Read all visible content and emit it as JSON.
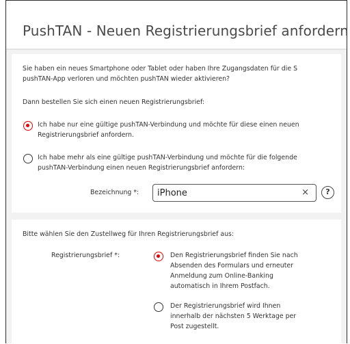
{
  "title": "PushTAN - Neuen Registrierungsbrief anfordern",
  "intro": {
    "line1": "Sie haben ein neues Smartphone oder Tablet oder haben Ihre Zugangsdaten für die S",
    "line2": "pushTAN-App verloren und möchten pushTAN wieder aktivieren?",
    "prompt": "Dann bestellen Sie sich einen neuen Registrierungsbrief:"
  },
  "options": [
    {
      "selected": true,
      "line1": "Ich habe nur eine gültige pushTAN-Verbindung und möchte für diese einen neuen",
      "line2": "Registrierungsbrief anfordern."
    },
    {
      "selected": false,
      "line1": "Ich habe mehr als eine gültige pushTAN-Verbindung und möchte für die folgende",
      "line2": "pushTAN-Verbindung einen neuen Registrierungsbrief anfordern:"
    }
  ],
  "bezeichnung": {
    "label": "Bezeichnung",
    "required_mark": "*:",
    "value": "iPhone",
    "clear_icon": "×",
    "help_icon": "?"
  },
  "delivery": {
    "prompt": "Bitte wählen Sie den Zustellweg für Ihren Registrierungsbrief aus:",
    "label": "Registrierungsbrief",
    "required_mark": "*:",
    "options": [
      {
        "selected": true,
        "lines": [
          "Den Registrierungsbrief finden Sie nach",
          "Absenden des Formulars und erneuter",
          "Anmeldung zum Online-Banking",
          "automatisch in Ihrem Postfach."
        ]
      },
      {
        "selected": false,
        "lines": [
          "Der Registrierungsbrief wird Ihnen",
          "innerhalb der nächsten 5 Werktage per",
          "Post zugestellt."
        ]
      }
    ]
  },
  "colors": {
    "accent": "#e60000",
    "background": "#f2f2f2"
  }
}
